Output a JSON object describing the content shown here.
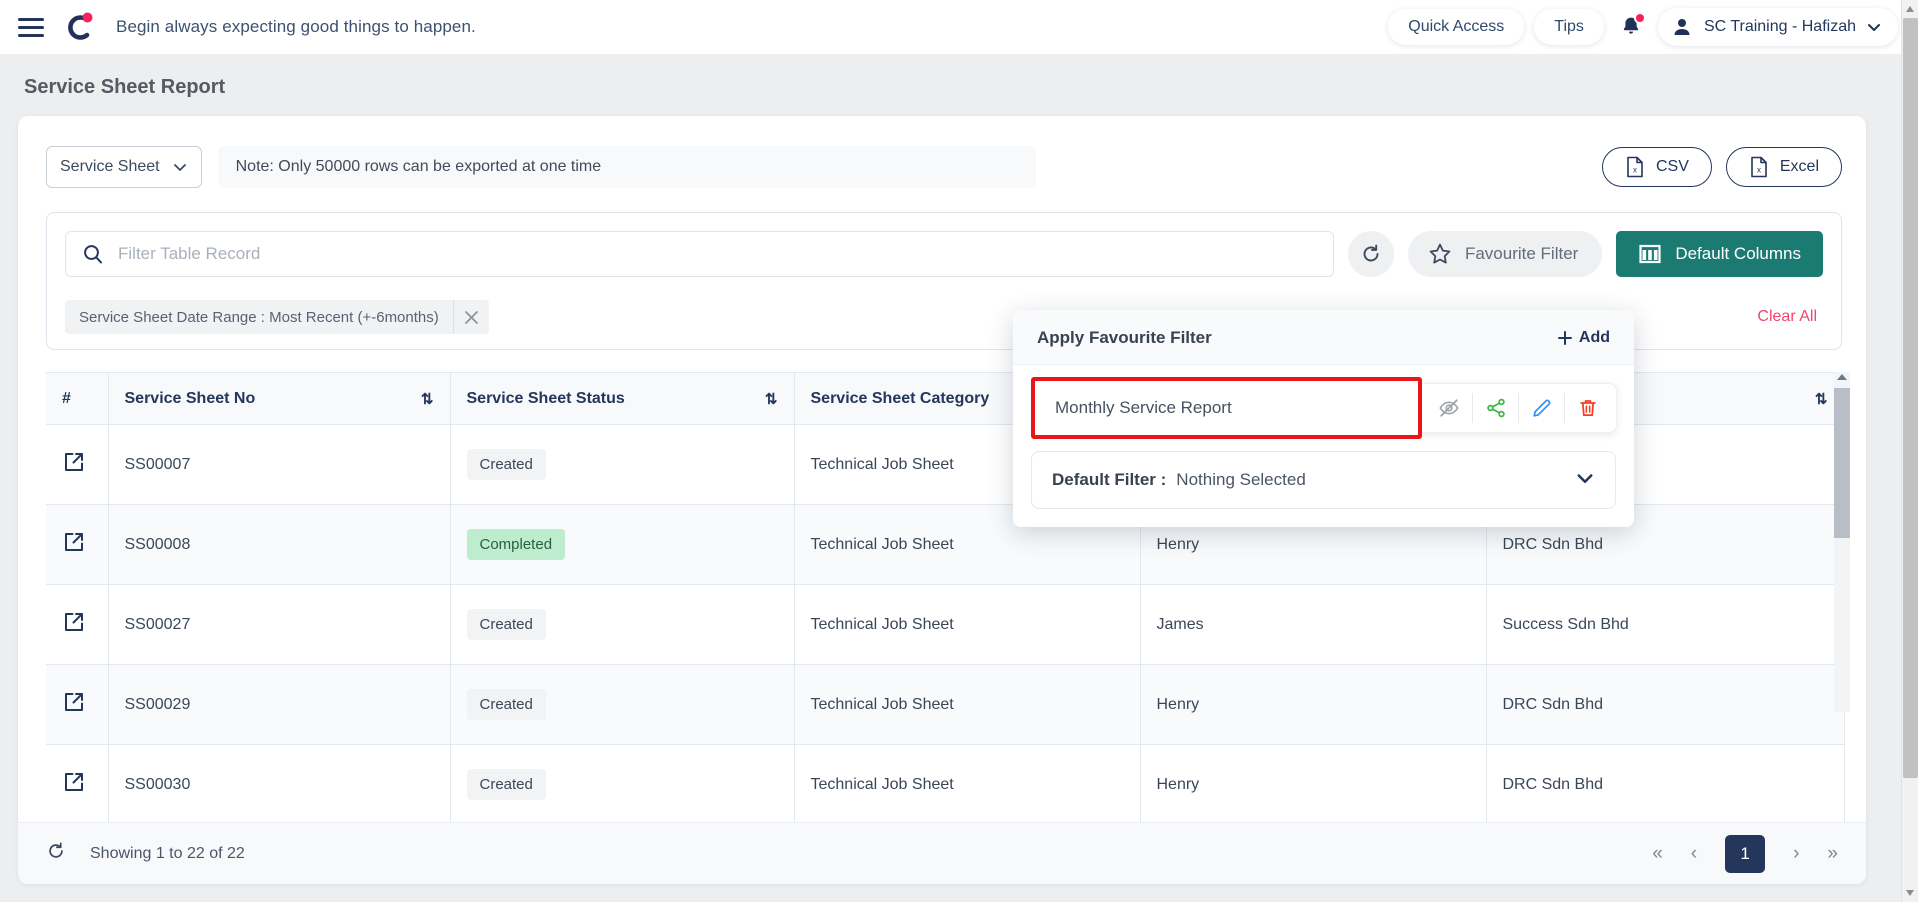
{
  "topnav": {
    "menu_icon": "hamburger-icon",
    "logo_icon": "brand-logo",
    "tagline": "Begin always expecting good things to happen.",
    "quick_access": "Quick Access",
    "tips": "Tips",
    "notification_icon": "bell-icon",
    "user": "SC Training - Hafizah"
  },
  "page": {
    "title": "Service Sheet Report"
  },
  "export": {
    "select_value": "Service Sheet",
    "note": "Note: Only 50000 rows can be exported at one time",
    "csv": "CSV",
    "excel": "Excel"
  },
  "filters": {
    "search_placeholder": "Filter Table Record",
    "search_value": "",
    "refresh_icon": "refresh-icon",
    "favourite_filter": "Favourite Filter",
    "default_columns": "Default Columns",
    "chip": "Service Sheet Date Range : Most Recent (+-6months)",
    "clear_all": "Clear All"
  },
  "popover": {
    "title": "Apply Favourite Filter",
    "add": "Add",
    "item_name": "Monthly Service Report",
    "actions": [
      "hide-icon",
      "share-icon",
      "edit-icon",
      "delete-icon"
    ],
    "default_filter_label": "Default Filter :",
    "default_filter_value": "Nothing Selected",
    "highlight_color": "#e8161a"
  },
  "table": {
    "columns": [
      {
        "label": "#",
        "sortable": false
      },
      {
        "label": "Service Sheet No",
        "sortable": true
      },
      {
        "label": "Service Sheet Status",
        "sortable": true
      },
      {
        "label": "Service Sheet Category",
        "sortable": false
      },
      {
        "label": "",
        "sortable": false
      },
      {
        "label": "",
        "sortable": true
      }
    ],
    "rows": [
      {
        "no": "SS00007",
        "status": "Created",
        "status_type": "created",
        "category": "Technical Job Sheet",
        "owner": "",
        "customer": ""
      },
      {
        "no": "SS00008",
        "status": "Completed",
        "status_type": "completed",
        "category": "Technical Job Sheet",
        "owner": "Henry",
        "customer": "DRC Sdn Bhd"
      },
      {
        "no": "SS00027",
        "status": "Created",
        "status_type": "created",
        "category": "Technical Job Sheet",
        "owner": "James",
        "customer": "Success Sdn Bhd"
      },
      {
        "no": "SS00029",
        "status": "Created",
        "status_type": "created",
        "category": "Technical Job Sheet",
        "owner": "Henry",
        "customer": "DRC Sdn Bhd"
      },
      {
        "no": "SS00030",
        "status": "Created",
        "status_type": "created",
        "category": "Technical Job Sheet",
        "owner": "Henry",
        "customer": "DRC Sdn Bhd"
      }
    ]
  },
  "footer": {
    "refresh_icon": "refresh-icon",
    "showing": "Showing 1 to 22 of 22",
    "first": "«",
    "prev": "‹",
    "current_page": "1",
    "next": "›",
    "last": "»"
  },
  "colors": {
    "accent_teal": "#1b7b72",
    "navy": "#24365c",
    "pink": "#f1456b",
    "badge_completed_bg": "#bdeccf"
  }
}
